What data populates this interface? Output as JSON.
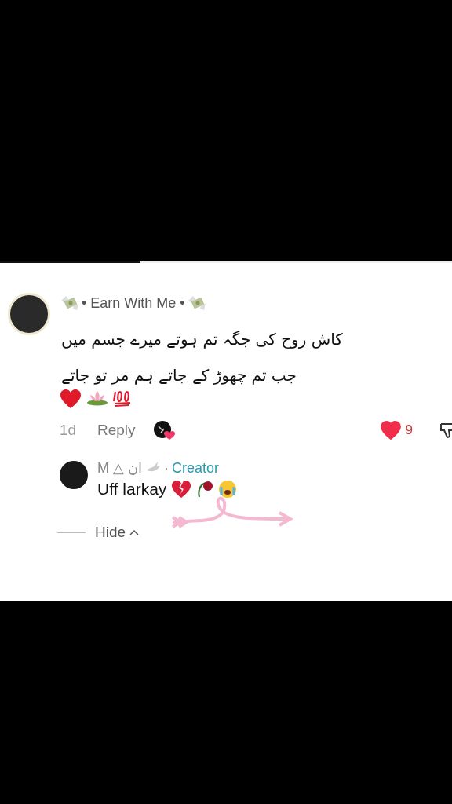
{
  "video_progress": {
    "level": 0.31
  },
  "comment": {
    "username": "• Earn With Me •",
    "lines": [
      "کاش روح کی جگہ تم ہوتے میرے جسم میں",
      "جب تم چھوڑ کے جاتے ہم مر تو جاتے"
    ],
    "time": "1d",
    "reply_label": "Reply",
    "liked": true,
    "like_count": "9",
    "reply": {
      "username": "M △ ان",
      "separator": "·",
      "badge": "Creator",
      "text": "Uff larkay"
    }
  },
  "hide_label": "Hide"
}
